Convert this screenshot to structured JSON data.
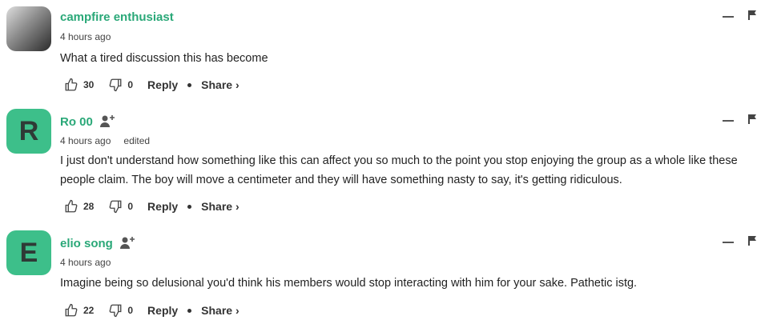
{
  "comments": [
    {
      "username": "campfire enthusiast",
      "time": "4 hours ago",
      "edited": "",
      "text": "What a tired discussion this has become",
      "likes": "30",
      "dislikes": "0",
      "reply_label": "Reply",
      "share_label": "Share ›",
      "avatar_letter": ""
    },
    {
      "username": "Ro 00",
      "time": "4 hours ago",
      "edited": "edited",
      "text": "I just don't understand how something like this can affect you so much to the point you stop enjoying the group as a whole like these people claim. The boy will move a centimeter and they will have something nasty to say, it's getting ridiculous.",
      "likes": "28",
      "dislikes": "0",
      "reply_label": "Reply",
      "share_label": "Share ›",
      "avatar_letter": "R"
    },
    {
      "username": "elio song",
      "time": "4 hours ago",
      "edited": "",
      "text": "Imagine being so delusional you'd think his members would stop interacting with him for your sake. Pathetic istg.",
      "likes": "22",
      "dislikes": "0",
      "reply_label": "Reply",
      "share_label": "Share ›",
      "avatar_letter": "E"
    }
  ],
  "colors": {
    "username": "#2aa878",
    "avatar_bg": "#3dbf8a",
    "avatar_text": "#2f3a36"
  },
  "icons": [
    "thumbs-up-icon",
    "thumbs-down-icon",
    "follow-user-icon",
    "flag-icon",
    "collapse-icon"
  ]
}
